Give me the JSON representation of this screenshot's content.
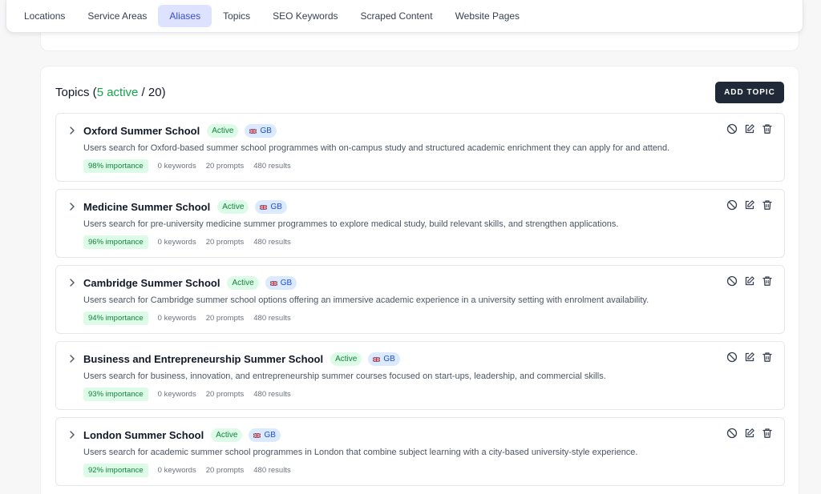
{
  "nav": {
    "tabs": [
      {
        "label": "Locations"
      },
      {
        "label": "Service Areas"
      },
      {
        "label": "Aliases",
        "active": true
      },
      {
        "label": "Topics"
      },
      {
        "label": "SEO Keywords"
      },
      {
        "label": "Scraped Content"
      },
      {
        "label": "Website Pages"
      }
    ]
  },
  "section": {
    "title_prefix": "Topics (",
    "active_text": "5 active",
    "total_text": " / 20)",
    "add_button": "ADD TOPIC"
  },
  "topics": [
    {
      "name": "Oxford Summer School",
      "status": "Active",
      "region": "GB",
      "description": "Users search for Oxford-based summer school programmes with on-campus study and structured academic enrichment they can apply for and attend.",
      "importance": "98% importance",
      "keywords": "0 keywords",
      "prompts": "20 prompts",
      "results": "480 results"
    },
    {
      "name": "Medicine Summer School",
      "status": "Active",
      "region": "GB",
      "description": "Users search for pre-university medicine summer programmes to explore medical study, build relevant skills, and strengthen applications.",
      "importance": "96% importance",
      "keywords": "0 keywords",
      "prompts": "20 prompts",
      "results": "480 results"
    },
    {
      "name": "Cambridge Summer School",
      "status": "Active",
      "region": "GB",
      "description": "Users search for Cambridge summer school options offering an immersive academic experience in a university setting with enrolment availability.",
      "importance": "94% importance",
      "keywords": "0 keywords",
      "prompts": "20 prompts",
      "results": "480 results"
    },
    {
      "name": "Business and Entrepreneurship Summer School",
      "status": "Active",
      "region": "GB",
      "description": "Users search for business, innovation, and entrepreneurship summer courses focused on start-ups, leadership, and commercial skills.",
      "importance": "93% importance",
      "keywords": "0 keywords",
      "prompts": "20 prompts",
      "results": "480 results"
    },
    {
      "name": "London Summer School",
      "status": "Active",
      "region": "GB",
      "description": "Users search for academic summer school programmes in London that combine subject learning with a city-based university-style experience.",
      "importance": "92% importance",
      "keywords": "0 keywords",
      "prompts": "20 prompts",
      "results": "480 results"
    }
  ],
  "colors": {
    "accent": "#3b4cca",
    "active_green": "#16a34a",
    "button_dark": "#1f2937"
  },
  "icons": {
    "expand": "chevron-right-icon",
    "disable": "ban-icon",
    "edit": "edit-icon",
    "delete": "trash-icon",
    "flag": "uk-flag-icon"
  }
}
